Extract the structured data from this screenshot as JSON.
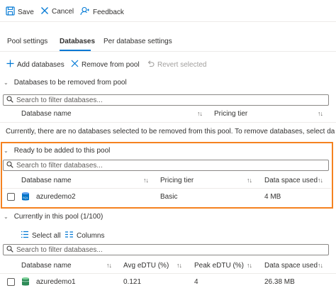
{
  "toolbar": {
    "save_label": "Save",
    "cancel_label": "Cancel",
    "feedback_label": "Feedback"
  },
  "tabs": [
    {
      "label": "Pool settings",
      "active": false
    },
    {
      "label": "Databases",
      "active": true
    },
    {
      "label": "Per database settings",
      "active": false
    }
  ],
  "actions": {
    "add_label": "Add databases",
    "remove_label": "Remove from pool",
    "revert_label": "Revert selected"
  },
  "colors": {
    "accent": "#0078d4",
    "highlight": "#f58220"
  },
  "remove_section": {
    "title": "Databases to be removed from pool",
    "search_placeholder": "Search to filter databases...",
    "columns": [
      "Database name",
      "Pricing tier"
    ],
    "empty_message": "Currently, there are no databases selected to be removed from this pool. To remove databases, select dat"
  },
  "ready_section": {
    "title": "Ready to be added to this pool",
    "search_placeholder": "Search to filter databases...",
    "columns": [
      "Database name",
      "Pricing tier",
      "Data space used"
    ],
    "rows": [
      {
        "name": "azuredemo2",
        "tier": "Basic",
        "space": "4 MB"
      }
    ]
  },
  "current_section": {
    "title": "Currently in this pool (1/100)",
    "select_all_label": "Select all",
    "columns_label": "Columns",
    "search_placeholder": "Search to filter databases...",
    "columns": [
      "Database name",
      "Avg eDTU (%)",
      "Peak eDTU (%)",
      "Data space used"
    ],
    "rows": [
      {
        "name": "azuredemo1",
        "avg": "0.121",
        "peak": "4",
        "space": "26.38 MB"
      }
    ]
  }
}
